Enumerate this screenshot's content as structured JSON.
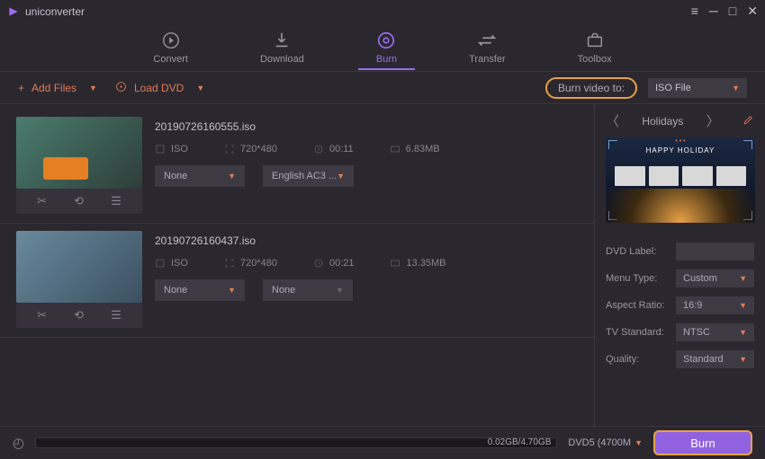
{
  "app": {
    "title": "uniconverter"
  },
  "nav": {
    "items": [
      {
        "label": "Convert"
      },
      {
        "label": "Download"
      },
      {
        "label": "Burn"
      },
      {
        "label": "Transfer"
      },
      {
        "label": "Toolbox"
      }
    ]
  },
  "toolbar": {
    "add_files": "Add Files",
    "load_dvd": "Load DVD",
    "burn_to_label": "Burn video to:",
    "dest": "ISO File"
  },
  "files": [
    {
      "name": "20190726160555.iso",
      "format": "ISO",
      "resolution": "720*480",
      "duration": "00:11",
      "size": "6.83MB",
      "subtitle": "None",
      "audio": "English AC3 ..."
    },
    {
      "name": "20190726160437.iso",
      "format": "ISO",
      "resolution": "720*480",
      "duration": "00:21",
      "size": "13.35MB",
      "subtitle": "None",
      "audio": "None"
    }
  ],
  "template": {
    "name": "Holidays",
    "banner": "HAPPY HOLIDAY"
  },
  "settings": {
    "dvd_label": {
      "label": "DVD Label:",
      "value": ""
    },
    "menu_type": {
      "label": "Menu Type:",
      "value": "Custom"
    },
    "aspect_ratio": {
      "label": "Aspect Ratio:",
      "value": "16:9"
    },
    "tv_standard": {
      "label": "TV Standard:",
      "value": "NTSC"
    },
    "quality": {
      "label": "Quality:",
      "value": "Standard"
    }
  },
  "footer": {
    "progress_text": "0.02GB/4.70GB",
    "disc": "DVD5 (4700M",
    "burn": "Burn"
  }
}
